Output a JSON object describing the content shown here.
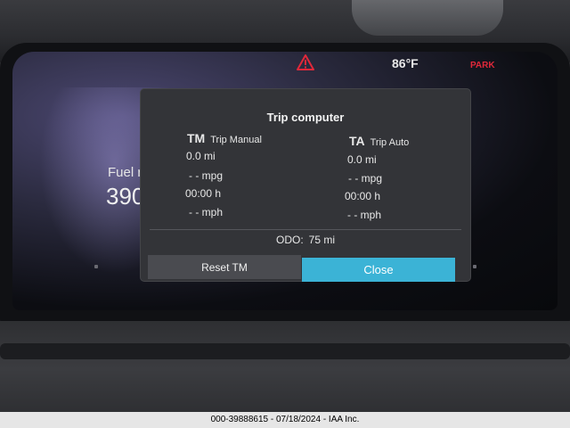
{
  "status": {
    "temperature": "86°F",
    "gear": "PARK",
    "warning_icon": "warning-triangle-icon"
  },
  "cluster": {
    "fuel_label": "Fuel ra",
    "fuel_value": "390"
  },
  "dialog": {
    "title": "Trip computer",
    "trip_manual": {
      "code": "TM",
      "name": "Trip Manual",
      "distance": "0.0 mi",
      "economy": "- - mpg",
      "time": "00:00 h",
      "speed": "- - mph"
    },
    "trip_auto": {
      "code": "TA",
      "name": "Trip Auto",
      "distance": "0.0 mi",
      "economy": "- - mpg",
      "time": "00:00 h",
      "speed": "- - mph"
    },
    "odo_label": "ODO:",
    "odo_value": "75 mi",
    "reset_label": "Reset TM",
    "close_label": "Close"
  },
  "caption": "000-39888615 - 07/18/2024 - IAA Inc.",
  "colors": {
    "accent": "#3bb3d6",
    "park": "#e0283a",
    "warning": "#e0283a"
  }
}
